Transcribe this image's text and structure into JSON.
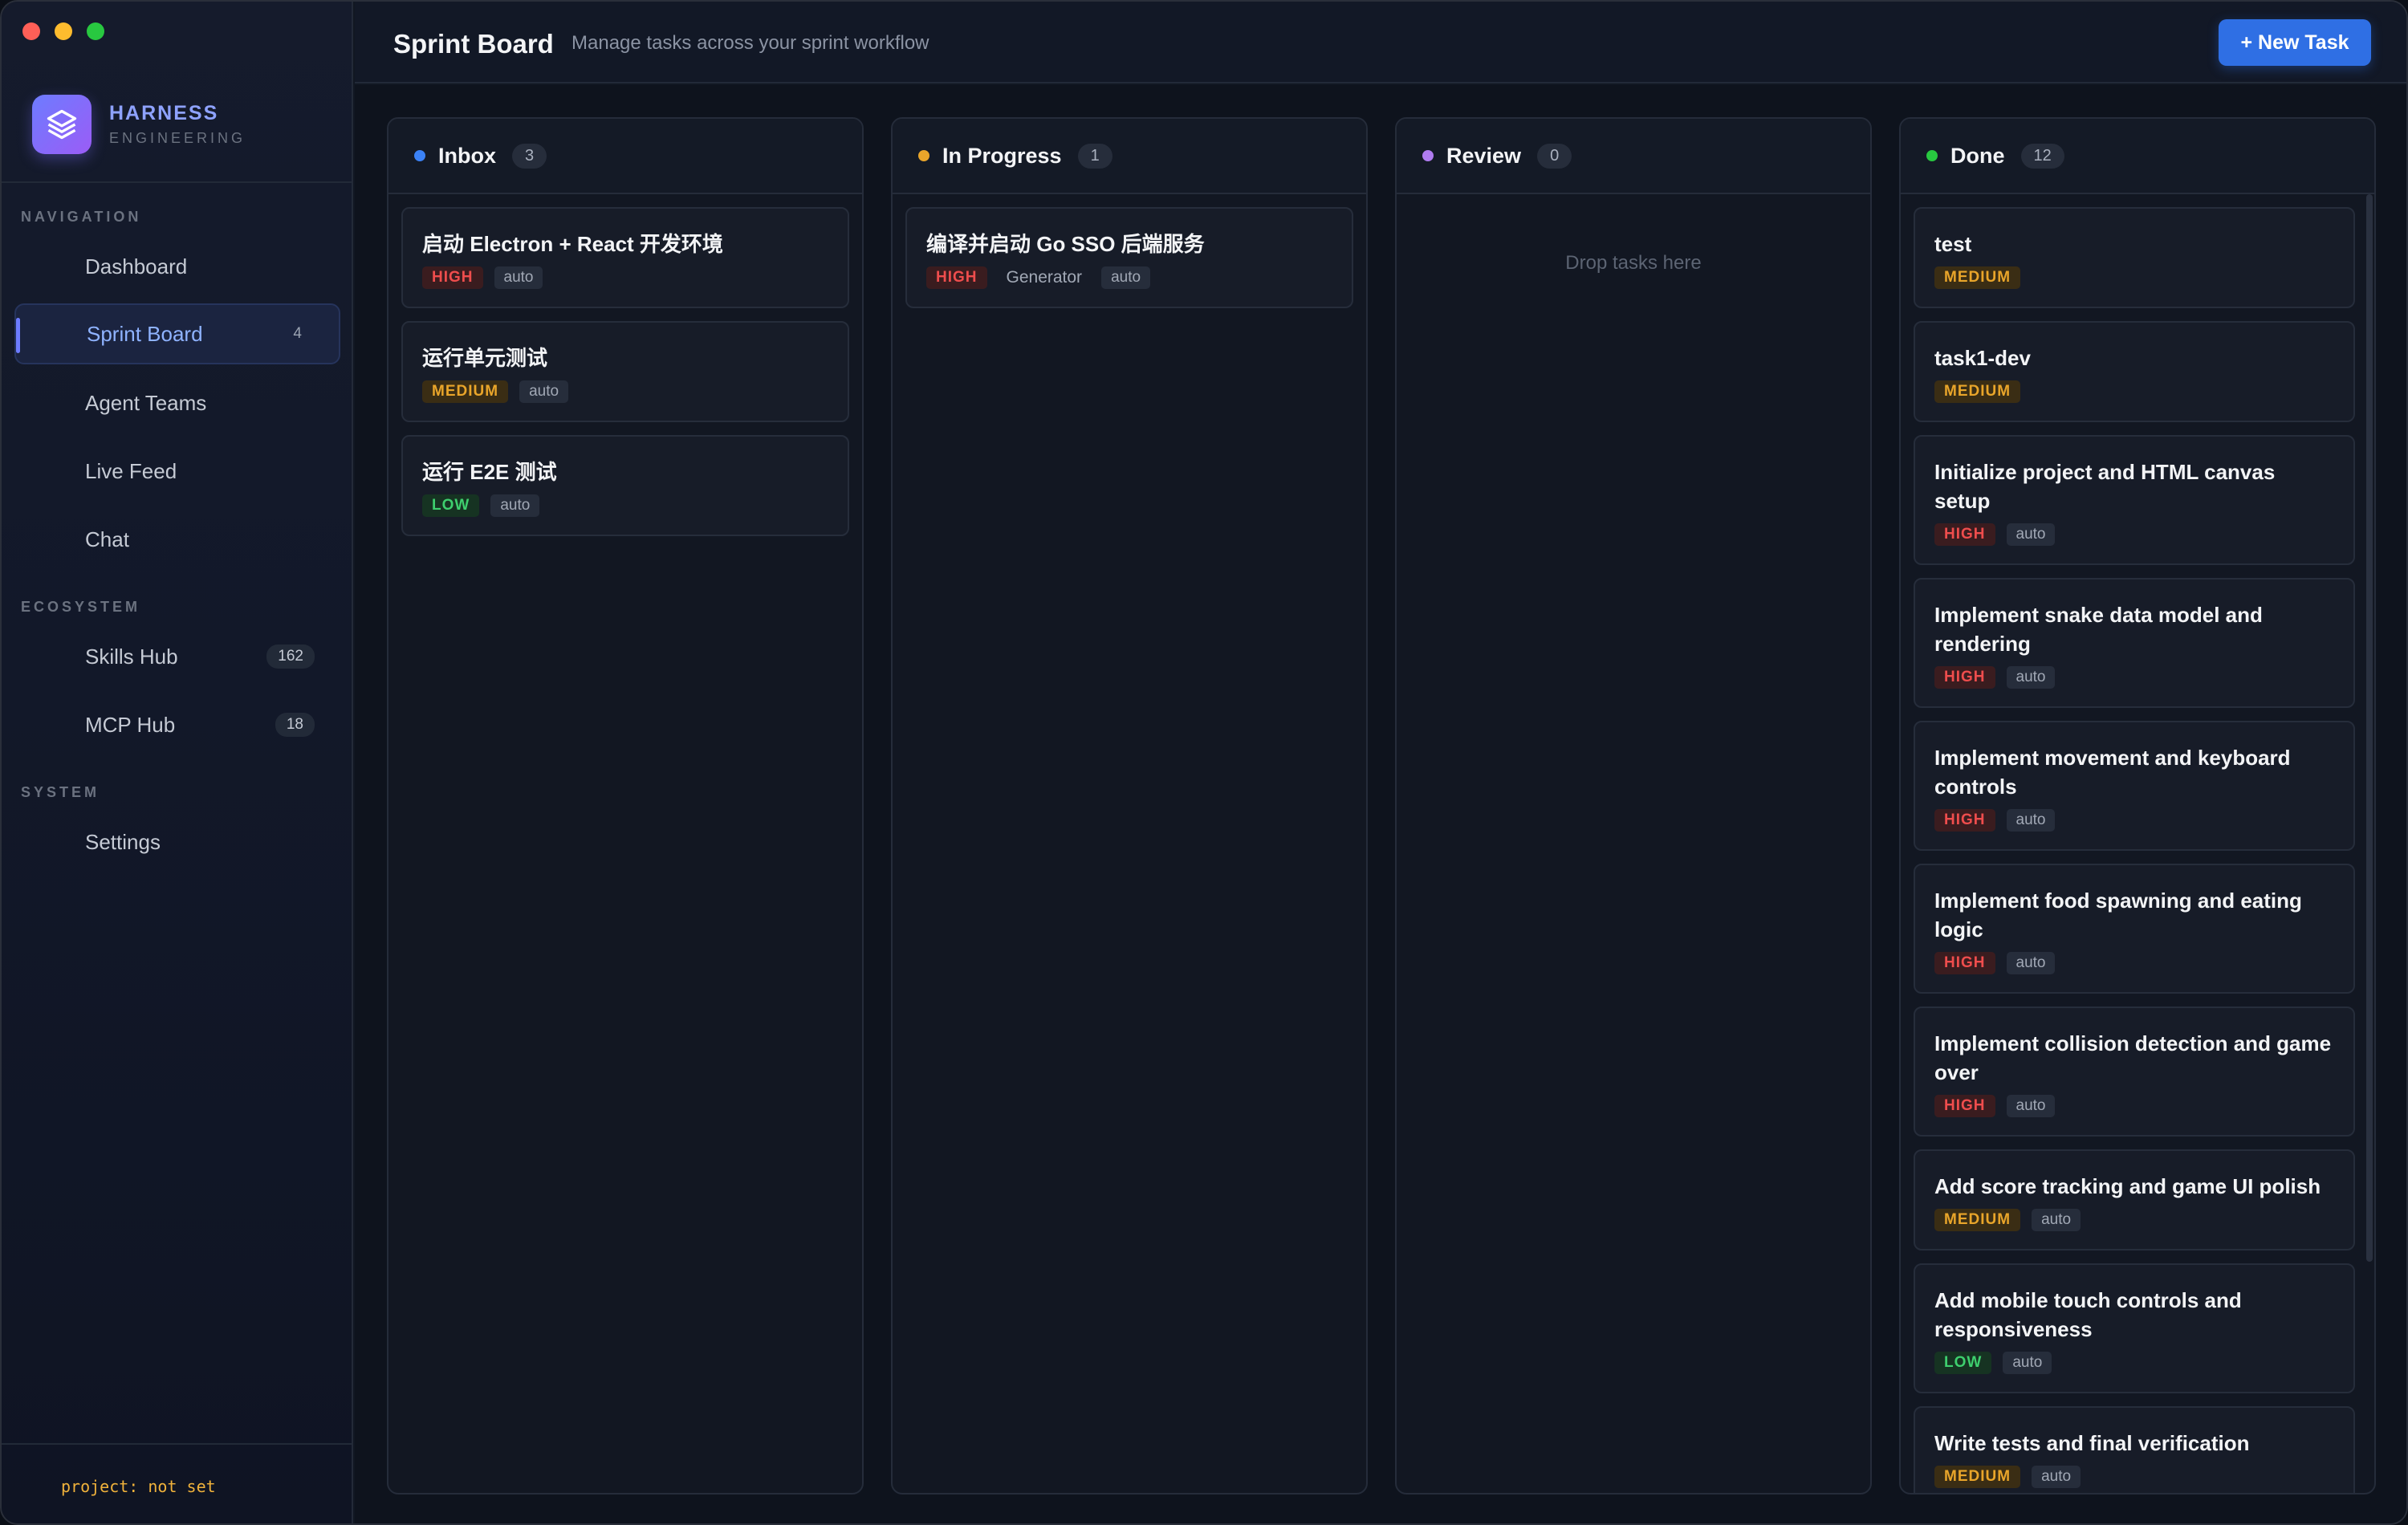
{
  "app": {
    "brand_name": "HARNESS",
    "brand_sub": "ENGINEERING"
  },
  "sidebar": {
    "sections": [
      {
        "label": "NAVIGATION"
      },
      {
        "label": "ECOSYSTEM"
      },
      {
        "label": "SYSTEM"
      }
    ],
    "items": [
      {
        "label": "Dashboard",
        "icon": "dashboard-icon"
      },
      {
        "label": "Sprint Board",
        "icon": "board-icon",
        "badge": "4",
        "active": true
      },
      {
        "label": "Agent Teams",
        "icon": "team-icon"
      },
      {
        "label": "Live Feed",
        "icon": "feed-icon"
      },
      {
        "label": "Chat",
        "icon": "chat-icon"
      },
      {
        "label": "Skills Hub",
        "icon": "skills-icon",
        "badge": "162"
      },
      {
        "label": "MCP Hub",
        "icon": "mcp-icon",
        "badge": "18"
      },
      {
        "label": "Settings",
        "icon": "settings-icon"
      }
    ],
    "footer": "project: not set"
  },
  "header": {
    "title": "Sprint Board",
    "subtitle": "Manage tasks across your sprint workflow",
    "new_task_label": "+ New Task"
  },
  "colors": {
    "accent": "#2f6fe4",
    "inbox_dot": "#3b82f6",
    "in_progress_dot": "#e9a52a",
    "review_dot": "#b07cf0",
    "done_dot": "#28c840",
    "high": "#ef4d4d",
    "medium": "#e9a52a",
    "low": "#3ecf6e"
  },
  "columns": [
    {
      "title": "Inbox",
      "count": "3",
      "cards": [
        {
          "title": "启动 Electron + React 开发环境",
          "priority": "HIGH",
          "tag": "auto"
        },
        {
          "title": "运行单元测试",
          "priority": "MEDIUM",
          "tag": "auto"
        },
        {
          "title": "运行 E2E 测试",
          "priority": "LOW",
          "tag": "auto"
        }
      ]
    },
    {
      "title": "In Progress",
      "count": "1",
      "cards": [
        {
          "title": "编译并启动 Go SSO 后端服务",
          "priority": "HIGH",
          "agent": "Generator",
          "tag": "auto"
        }
      ]
    },
    {
      "title": "Review",
      "count": "0",
      "empty_text": "Drop tasks here"
    },
    {
      "title": "Done",
      "count": "12",
      "cards": [
        {
          "title": "test",
          "priority": "MEDIUM"
        },
        {
          "title": "task1-dev",
          "priority": "MEDIUM"
        },
        {
          "title": "Initialize project and HTML canvas setup",
          "priority": "HIGH",
          "tag": "auto"
        },
        {
          "title": "Implement snake data model and rendering",
          "priority": "HIGH",
          "tag": "auto"
        },
        {
          "title": "Implement movement and keyboard controls",
          "priority": "HIGH",
          "tag": "auto"
        },
        {
          "title": "Implement food spawning and eating logic",
          "priority": "HIGH",
          "tag": "auto"
        },
        {
          "title": "Implement collision detection and game over",
          "priority": "HIGH",
          "tag": "auto"
        },
        {
          "title": "Add score tracking and game UI polish",
          "priority": "MEDIUM",
          "tag": "auto"
        },
        {
          "title": "Add mobile touch controls and responsiveness",
          "priority": "LOW",
          "tag": "auto"
        },
        {
          "title": "Write tests and final verification",
          "priority": "MEDIUM",
          "tag": "auto"
        }
      ]
    }
  ]
}
